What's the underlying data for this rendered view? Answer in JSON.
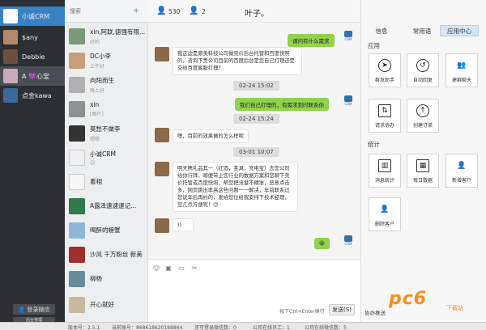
{
  "accounts": [
    {
      "name": "小诚CRM"
    },
    {
      "name": "$any"
    },
    {
      "name": "Debbie"
    },
    {
      "name": "A 💜心宝"
    },
    {
      "name": "点金kawa"
    }
  ],
  "sidebar_buttons": {
    "login": "登录微信",
    "admin": "后台管理"
  },
  "search": {
    "placeholder": "搜索"
  },
  "contacts": [
    {
      "name": "xin,阿联,德强有限...",
      "sub": "好的"
    },
    {
      "name": "DC小李",
      "sub": "上午好"
    },
    {
      "name": "向阳而生",
      "sub": "晚上好"
    },
    {
      "name": "xin",
      "sub": "[图片]"
    },
    {
      "name": "莫愁不做李",
      "sub": "嗯嗯"
    },
    {
      "name": "小诚CRM",
      "sub": "😊"
    },
    {
      "name": "着相",
      "sub": ""
    },
    {
      "name": "A露泽速速速记...",
      "sub": ""
    },
    {
      "name": "喝醉的螃蟹",
      "sub": ""
    },
    {
      "name": "沙风 千万粉丝 新美",
      "sub": ""
    },
    {
      "name": "柳杨",
      "sub": ""
    },
    {
      "name": "开心就好",
      "sub": ""
    }
  ],
  "chat_header": {
    "count1": "530",
    "count2": "2",
    "title": "叶子。"
  },
  "messages": {
    "m1": "请问有什么需求",
    "m2": "我这边是原美科技公司做竞价后台托管和百度快照的，咨询下贵公司目前的百度后台是您自己打理还是交给百度客服打理？",
    "ts1": "02-24 15:02",
    "m3": "我们自己打理的，有需求到时联系你",
    "ts2": "02-24 15:24",
    "m4": "嗯，目前的效果做的怎么样呢",
    "ts3": "03-01 10:07",
    "m5": "明天携礼品其一（红酒，茶具，充电宝）去您公司给你行拜，顺便带上您行业的数据方案和您聊下竞价托管或百度快照，帮您把流量不精准，恶意点击多，网页跳出率高这些问题一一解决，年前联系过您说年后再约的，发给您位给我安排下技术经理，您几点方便呢！😊",
    "voice": "))",
    "emoji": "😀"
  },
  "composer": {
    "hint": "按下Ctrl+Enter换行",
    "send": "发送(S)"
  },
  "right_tabs": {
    "info": "信息",
    "common": "常用语",
    "apps": "应用中心"
  },
  "sections": {
    "apps": "应用",
    "stats": "统计",
    "push": "协办推送"
  },
  "apps": [
    {
      "label": "群发助手",
      "icon": "send-icon"
    },
    {
      "label": "自动回复",
      "icon": "auto-reply-icon"
    },
    {
      "label": "建群聊天",
      "icon": "group-icon"
    },
    {
      "label": "请求协办",
      "icon": "assist-icon"
    },
    {
      "label": "创建订单",
      "icon": "order-icon"
    }
  ],
  "stats_apps": [
    {
      "label": "消息统计",
      "icon": "chart-icon"
    },
    {
      "label": "每日数据",
      "icon": "calendar-icon"
    },
    {
      "label": "新增客户",
      "icon": "add-user-icon"
    },
    {
      "label": "删除客户",
      "icon": "remove-user-icon"
    }
  ],
  "status": {
    "version": "版本号：2.5.1",
    "account": "当前账号：868618620188864",
    "logged": "还可登录微信数：0",
    "online": "公司在线员工：1",
    "online_wx": "公司在线微信数：5"
  },
  "watermark": {
    "text": "pc6",
    "sub": "下载站"
  },
  "colors": {
    "accent": "#3b82c4",
    "bubble_green": "#8fd34c",
    "dark_sidebar": "#2c2f33"
  }
}
